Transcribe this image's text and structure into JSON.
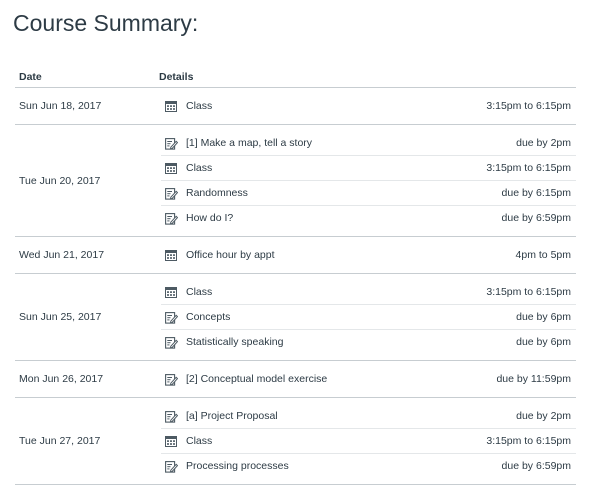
{
  "page": {
    "title": "Course Summary:"
  },
  "table": {
    "headers": {
      "date": "Date",
      "details": "Details"
    },
    "days": [
      {
        "date": "Sun Jun 18, 2017",
        "items": [
          {
            "type": "calendar-icon",
            "name": "Class",
            "time": "3:15pm to 6:15pm"
          }
        ]
      },
      {
        "date": "Tue Jun 20, 2017",
        "items": [
          {
            "type": "assignment-icon",
            "name": "[1] Make a map, tell a story",
            "time": "due by 2pm"
          },
          {
            "type": "calendar-icon",
            "name": "Class",
            "time": "3:15pm to 6:15pm"
          },
          {
            "type": "assignment-icon",
            "name": "Randomness",
            "time": "due by 6:15pm"
          },
          {
            "type": "assignment-icon",
            "name": "How do I?",
            "time": "due by 6:59pm"
          }
        ]
      },
      {
        "date": "Wed Jun 21, 2017",
        "items": [
          {
            "type": "calendar-icon",
            "name": "Office hour by appt",
            "time": "4pm to 5pm"
          }
        ]
      },
      {
        "date": "Sun Jun 25, 2017",
        "items": [
          {
            "type": "calendar-icon",
            "name": "Class",
            "time": "3:15pm to 6:15pm"
          },
          {
            "type": "assignment-icon",
            "name": "Concepts",
            "time": "due by 6pm"
          },
          {
            "type": "assignment-icon",
            "name": "Statistically speaking",
            "time": "due by 6pm"
          }
        ]
      },
      {
        "date": "Mon Jun 26, 2017",
        "items": [
          {
            "type": "assignment-icon",
            "name": "[2] Conceptual model exercise",
            "time": "due by 11:59pm"
          }
        ]
      },
      {
        "date": "Tue Jun 27, 2017",
        "items": [
          {
            "type": "assignment-icon",
            "name": "[a] Project Proposal",
            "time": "due by 2pm"
          },
          {
            "type": "calendar-icon",
            "name": "Class",
            "time": "3:15pm to 6:15pm"
          },
          {
            "type": "assignment-icon",
            "name": "Processing processes",
            "time": "due by 6:59pm"
          }
        ]
      }
    ]
  }
}
